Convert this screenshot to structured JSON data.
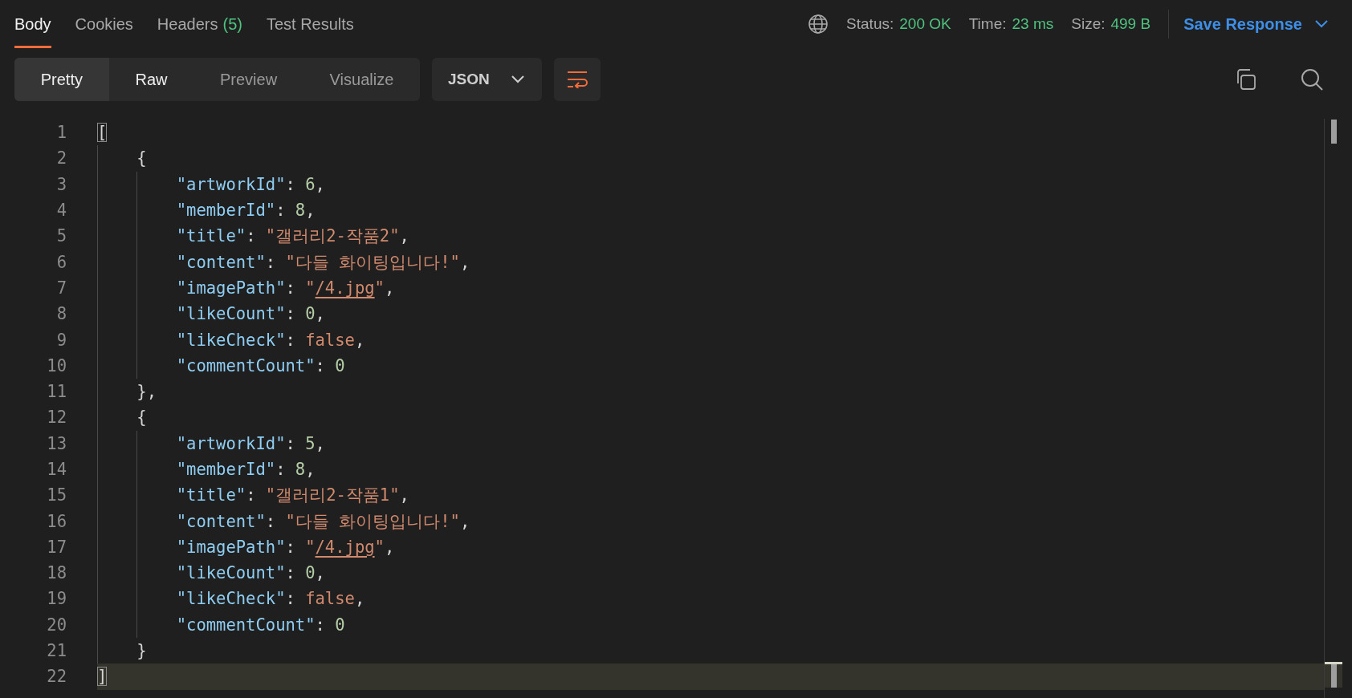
{
  "tabs": [
    {
      "label": "Body",
      "selected": true
    },
    {
      "label": "Cookies",
      "selected": false
    },
    {
      "label": "Headers",
      "count": "(5)",
      "selected": false
    },
    {
      "label": "Test Results",
      "selected": false
    }
  ],
  "response_meta": [
    {
      "label": "Status:",
      "value": "200 OK"
    },
    {
      "label": "Time:",
      "value": "23 ms"
    },
    {
      "label": "Size:",
      "value": "499 B"
    }
  ],
  "save_button": {
    "label": "Save Response"
  },
  "view_modes": [
    {
      "label": "Pretty",
      "selected": true,
      "disabled": false
    },
    {
      "label": "Raw",
      "selected": false,
      "disabled": false
    },
    {
      "label": "Preview",
      "selected": false,
      "disabled": true
    },
    {
      "label": "Visualize",
      "selected": false,
      "disabled": true
    }
  ],
  "format_dropdown": {
    "value": "JSON"
  },
  "editor": {
    "document": {
      "open": {
        "number": "1",
        "current": false,
        "tokens": [
          {
            "kind": "matched-bracket",
            "text": "["
          }
        ]
      },
      "children": [
        {
          "open": {
            "number": "2",
            "current": false,
            "tokens": [
              {
                "kind": "punct",
                "text": "{"
              }
            ]
          },
          "lines": [
            {
              "number": "3",
              "current": false,
              "tokens": [
                {
                  "kind": "key",
                  "text": "\"artworkId\""
                },
                {
                  "kind": "punct",
                  "text": ": "
                },
                {
                  "kind": "number",
                  "text": "6"
                },
                {
                  "kind": "punct",
                  "text": ","
                }
              ]
            },
            {
              "number": "4",
              "current": false,
              "tokens": [
                {
                  "kind": "key",
                  "text": "\"memberId\""
                },
                {
                  "kind": "punct",
                  "text": ": "
                },
                {
                  "kind": "number",
                  "text": "8"
                },
                {
                  "kind": "punct",
                  "text": ","
                }
              ]
            },
            {
              "number": "5",
              "current": false,
              "tokens": [
                {
                  "kind": "key",
                  "text": "\"title\""
                },
                {
                  "kind": "punct",
                  "text": ": "
                },
                {
                  "kind": "string",
                  "text": "\"갤러리2-작품2\""
                },
                {
                  "kind": "punct",
                  "text": ","
                }
              ]
            },
            {
              "number": "6",
              "current": false,
              "tokens": [
                {
                  "kind": "key",
                  "text": "\"content\""
                },
                {
                  "kind": "punct",
                  "text": ": "
                },
                {
                  "kind": "string",
                  "text": "\"다들 화이팅입니다!\""
                },
                {
                  "kind": "punct",
                  "text": ","
                }
              ]
            },
            {
              "number": "7",
              "current": false,
              "tokens": [
                {
                  "kind": "key",
                  "text": "\"imagePath\""
                },
                {
                  "kind": "punct",
                  "text": ": "
                },
                {
                  "kind": "string",
                  "text": "\""
                },
                {
                  "kind": "link",
                  "text": "/4.jpg"
                },
                {
                  "kind": "string",
                  "text": "\""
                },
                {
                  "kind": "punct",
                  "text": ","
                }
              ]
            },
            {
              "number": "8",
              "current": false,
              "tokens": [
                {
                  "kind": "key",
                  "text": "\"likeCount\""
                },
                {
                  "kind": "punct",
                  "text": ": "
                },
                {
                  "kind": "number",
                  "text": "0"
                },
                {
                  "kind": "punct",
                  "text": ","
                }
              ]
            },
            {
              "number": "9",
              "current": false,
              "tokens": [
                {
                  "kind": "key",
                  "text": "\"likeCheck\""
                },
                {
                  "kind": "punct",
                  "text": ": "
                },
                {
                  "kind": "boolean",
                  "text": "false"
                },
                {
                  "kind": "punct",
                  "text": ","
                }
              ]
            },
            {
              "number": "10",
              "current": false,
              "tokens": [
                {
                  "kind": "key",
                  "text": "\"commentCount\""
                },
                {
                  "kind": "punct",
                  "text": ": "
                },
                {
                  "kind": "number",
                  "text": "0"
                }
              ]
            }
          ],
          "close": {
            "number": "11",
            "current": false,
            "tokens": [
              {
                "kind": "punct",
                "text": "},"
              }
            ]
          }
        },
        {
          "open": {
            "number": "12",
            "current": false,
            "tokens": [
              {
                "kind": "punct",
                "text": "{"
              }
            ]
          },
          "lines": [
            {
              "number": "13",
              "current": false,
              "tokens": [
                {
                  "kind": "key",
                  "text": "\"artworkId\""
                },
                {
                  "kind": "punct",
                  "text": ": "
                },
                {
                  "kind": "number",
                  "text": "5"
                },
                {
                  "kind": "punct",
                  "text": ","
                }
              ]
            },
            {
              "number": "14",
              "current": false,
              "tokens": [
                {
                  "kind": "key",
                  "text": "\"memberId\""
                },
                {
                  "kind": "punct",
                  "text": ": "
                },
                {
                  "kind": "number",
                  "text": "8"
                },
                {
                  "kind": "punct",
                  "text": ","
                }
              ]
            },
            {
              "number": "15",
              "current": false,
              "tokens": [
                {
                  "kind": "key",
                  "text": "\"title\""
                },
                {
                  "kind": "punct",
                  "text": ": "
                },
                {
                  "kind": "string",
                  "text": "\"갤러리2-작품1\""
                },
                {
                  "kind": "punct",
                  "text": ","
                }
              ]
            },
            {
              "number": "16",
              "current": false,
              "tokens": [
                {
                  "kind": "key",
                  "text": "\"content\""
                },
                {
                  "kind": "punct",
                  "text": ": "
                },
                {
                  "kind": "string",
                  "text": "\"다들 화이팅입니다!\""
                },
                {
                  "kind": "punct",
                  "text": ","
                }
              ]
            },
            {
              "number": "17",
              "current": false,
              "tokens": [
                {
                  "kind": "key",
                  "text": "\"imagePath\""
                },
                {
                  "kind": "punct",
                  "text": ": "
                },
                {
                  "kind": "string",
                  "text": "\""
                },
                {
                  "kind": "link",
                  "text": "/4.jpg"
                },
                {
                  "kind": "string",
                  "text": "\""
                },
                {
                  "kind": "punct",
                  "text": ","
                }
              ]
            },
            {
              "number": "18",
              "current": false,
              "tokens": [
                {
                  "kind": "key",
                  "text": "\"likeCount\""
                },
                {
                  "kind": "punct",
                  "text": ": "
                },
                {
                  "kind": "number",
                  "text": "0"
                },
                {
                  "kind": "punct",
                  "text": ","
                }
              ]
            },
            {
              "number": "19",
              "current": false,
              "tokens": [
                {
                  "kind": "key",
                  "text": "\"likeCheck\""
                },
                {
                  "kind": "punct",
                  "text": ": "
                },
                {
                  "kind": "boolean",
                  "text": "false"
                },
                {
                  "kind": "punct",
                  "text": ","
                }
              ]
            },
            {
              "number": "20",
              "current": false,
              "tokens": [
                {
                  "kind": "key",
                  "text": "\"commentCount\""
                },
                {
                  "kind": "punct",
                  "text": ": "
                },
                {
                  "kind": "number",
                  "text": "0"
                }
              ]
            }
          ],
          "close": {
            "number": "21",
            "current": false,
            "tokens": [
              {
                "kind": "punct",
                "text": "}"
              }
            ]
          }
        }
      ],
      "close": {
        "number": "22",
        "current": true,
        "tokens": [
          {
            "kind": "matched-bracket",
            "text": "]"
          }
        ]
      }
    }
  }
}
